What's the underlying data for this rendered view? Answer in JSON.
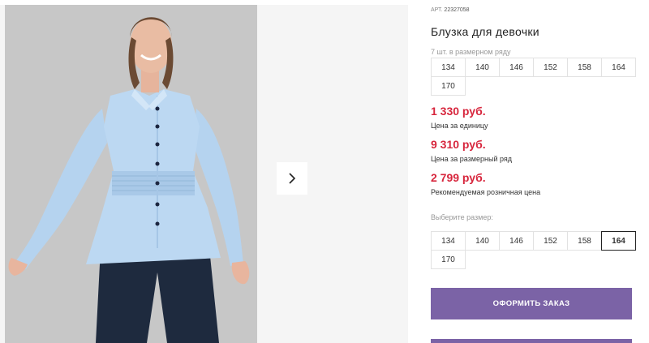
{
  "gallery": {
    "photo_alt": "product-photo",
    "next_icon": "chevron-right-icon"
  },
  "product": {
    "sku_prefix": "АРТ.",
    "sku": "22327058",
    "title": "Блузка для девочки",
    "range_caption": "7 шт. в размерном ряду",
    "range_sizes": [
      "134",
      "140",
      "146",
      "152",
      "158",
      "164",
      "170"
    ],
    "prices": [
      {
        "value": "1 330 руб.",
        "label": "Цена за единицу"
      },
      {
        "value": "9 310 руб.",
        "label": "Цена за размерный ряд"
      },
      {
        "value": "2 799 руб.",
        "label": "Рекомендуемая розничная цена"
      }
    ],
    "choose_caption": "Выберите размер:",
    "select_sizes": [
      "134",
      "140",
      "146",
      "152",
      "158",
      "164",
      "170"
    ],
    "selected_size": "164",
    "order_button": "ОФОРМИТЬ ЗАКАЗ"
  },
  "colors": {
    "price": "#d7263d",
    "button": "#7b63a6"
  }
}
